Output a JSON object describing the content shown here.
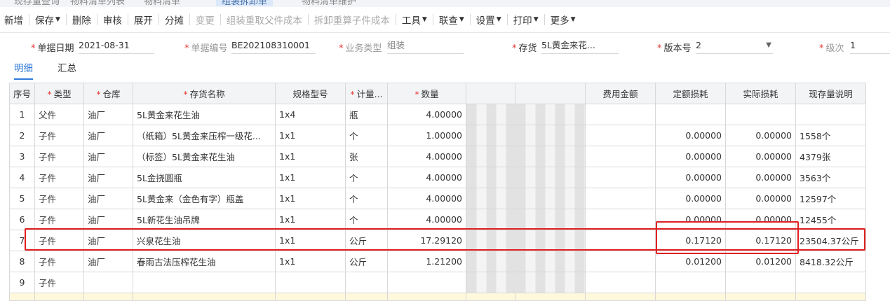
{
  "tabs": [
    "现存量查询",
    "物料清单列表",
    "物料清单",
    "组装拆卸单",
    "物料清单维护"
  ],
  "toolbar": {
    "new": "新增",
    "save": "保存",
    "delete": "删除",
    "audit": "审核",
    "expand": "展开",
    "allocate": "分摊",
    "change": "变更",
    "refetch_parent": "组装重取父件成本",
    "recalc_child": "拆卸重算子件成本",
    "tools": "工具",
    "link": "联查",
    "settings": "设置",
    "print": "打印",
    "more": "更多"
  },
  "form": {
    "date_label": "单据日期",
    "date_value": "2021-08-31",
    "code_label": "单据编号",
    "code_value": "BE202108310001",
    "type_label": "业务类型",
    "type_value": "组装",
    "stock_label": "存货",
    "stock_value": "5L黄金来花...",
    "version_label": "版本号",
    "version_value": "2",
    "level_label": "级次",
    "level_value": "1"
  },
  "subtabs": {
    "detail": "明细",
    "summary": "汇总"
  },
  "grid": {
    "headers": [
      "序号",
      "类型",
      "仓库",
      "存货名称",
      "规格型号",
      "计量...",
      "数量",
      "",
      "",
      "费用金额",
      "定额损耗",
      "实际损耗",
      "现存量说明"
    ],
    "rows": [
      [
        "1",
        "父件",
        "油厂",
        "5L黄金来花生油",
        "1x4",
        "瓶",
        "4.00000",
        "",
        "",
        "",
        "",
        "",
        ""
      ],
      [
        "2",
        "子件",
        "油厂",
        "（纸箱）5L黄金来压榨一级花...",
        "1x1",
        "个",
        "1.00000",
        "",
        "",
        "",
        "0.00000",
        "0.00000",
        "1558个"
      ],
      [
        "3",
        "子件",
        "油厂",
        "（标签）5L黄金来花生油",
        "1x1",
        "张",
        "4.00000",
        "",
        "",
        "",
        "0.00000",
        "0.00000",
        "4379张"
      ],
      [
        "4",
        "子件",
        "油厂",
        "5L金挠圆瓶",
        "1x1",
        "个",
        "4.00000",
        "",
        "",
        "",
        "0.00000",
        "0.00000",
        "3563个"
      ],
      [
        "5",
        "子件",
        "油厂",
        "5L黄金来（金色有字）瓶盖",
        "1x1",
        "个",
        "4.00000",
        "",
        "",
        "",
        "0.00000",
        "0.00000",
        "12597个"
      ],
      [
        "6",
        "子件",
        "油厂",
        "5L新花生油吊牌",
        "1x1",
        "个",
        "4.00000",
        "",
        "",
        "",
        "0.00000",
        "0.00000",
        "12455个"
      ],
      [
        "7",
        "子件",
        "油厂",
        "兴泉花生油",
        "1x1",
        "公斤",
        "17.29120",
        "",
        "",
        "",
        "0.17120",
        "0.17120",
        "23504.37公斤"
      ],
      [
        "8",
        "子件",
        "油厂",
        "春雨古法压榨花生油",
        "1x1",
        "公斤",
        "1.21200",
        "",
        "",
        "",
        "0.01200",
        "0.01200",
        "8418.32公斤"
      ],
      [
        "9",
        "子件",
        "",
        "",
        "",
        "",
        "",
        "",
        "",
        "",
        "",
        "",
        ""
      ]
    ]
  }
}
